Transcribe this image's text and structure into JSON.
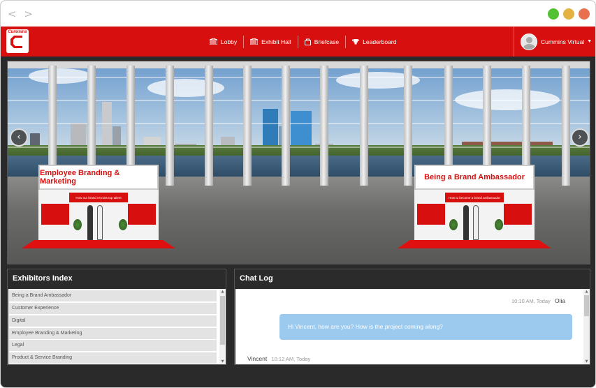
{
  "window": {
    "nav_back": "<",
    "nav_forward": ">"
  },
  "brand": {
    "logo_text": "Cummins"
  },
  "menu": [
    {
      "label": "Lobby",
      "icon": "building-icon"
    },
    {
      "label": "Exhibit Hall",
      "icon": "building-icon"
    },
    {
      "label": "Briefcase",
      "icon": "briefcase-icon"
    },
    {
      "label": "Leaderboard",
      "icon": "trophy-icon"
    }
  ],
  "user": {
    "name": "Cummins Virtual",
    "caret": "▼"
  },
  "scene": {
    "booth_left": {
      "title": "Employee Branding & Marketing",
      "banner": "How our brand recruits top talent"
    },
    "booth_right": {
      "title": "Being a Brand Ambassador",
      "banner": "How to become a brand ambassador"
    },
    "arrow_prev": "‹",
    "arrow_next": "›"
  },
  "exhibitors": {
    "title": "Exhibitors Index",
    "items": [
      "Being a Brand Ambassador",
      "Customer Experience",
      "Digital",
      "Employee Branding & Marketing",
      "Legal",
      "Product & Service Branding"
    ],
    "scroll_up": "▲",
    "scroll_down": "▼"
  },
  "chat": {
    "title": "Chat Log",
    "messages": [
      {
        "time": "10:10 AM, Today",
        "sender": "Olia",
        "text": "Hi Vincent, how are you? How is the project coming along?"
      },
      {
        "time": "10:12 AM, Today",
        "sender": "Vincent"
      }
    ],
    "scroll_up": "▲",
    "scroll_down": "▼"
  },
  "colors": {
    "brand_red": "#d7100f",
    "bubble": "#9ccaef",
    "panel_dark": "#2b2b2b"
  }
}
